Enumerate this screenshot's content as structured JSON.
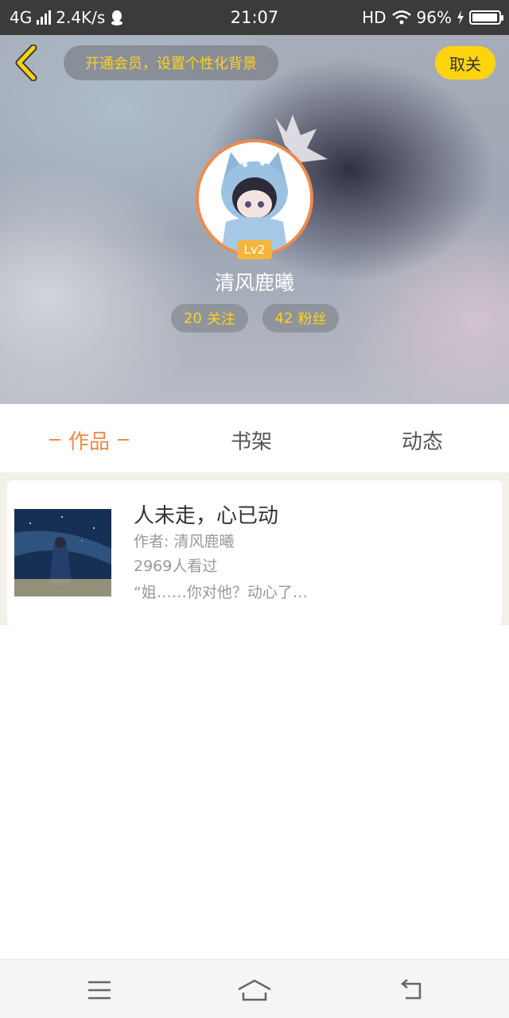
{
  "status_bar": {
    "network": "4G",
    "speed": "2.4K/s",
    "time": "21:07",
    "hd": "HD",
    "battery_text": "96%",
    "battery_level": 0.96,
    "icons": [
      "signal-icon",
      "qq-notification-icon",
      "wifi-icon",
      "charging-icon",
      "battery-icon"
    ]
  },
  "header": {
    "back_icon": "chevron-left-icon",
    "vip_banner": "开通会员，设置个性化背景",
    "unfollow_label": "取关",
    "level": "Lv2",
    "username": "清风鹿曦",
    "following": {
      "count": "20",
      "label": "关注"
    },
    "fans": {
      "count": "42",
      "label": "粉丝"
    }
  },
  "tabs": [
    {
      "label": "作品",
      "active": true
    },
    {
      "label": "书架",
      "active": false
    },
    {
      "label": "动态",
      "active": false
    }
  ],
  "works": [
    {
      "title": "人未走，心已动",
      "author": "作者: 清风鹿曦",
      "views": "2969人看过",
      "excerpt": "“姐……你对他？动心了…"
    }
  ],
  "nav": {
    "icons": [
      "menu-icon",
      "home-icon",
      "back-icon"
    ]
  },
  "colors": {
    "accent": "#f08a4a",
    "yellow": "#ffd40f",
    "status_bar": "#3b3b3b"
  }
}
